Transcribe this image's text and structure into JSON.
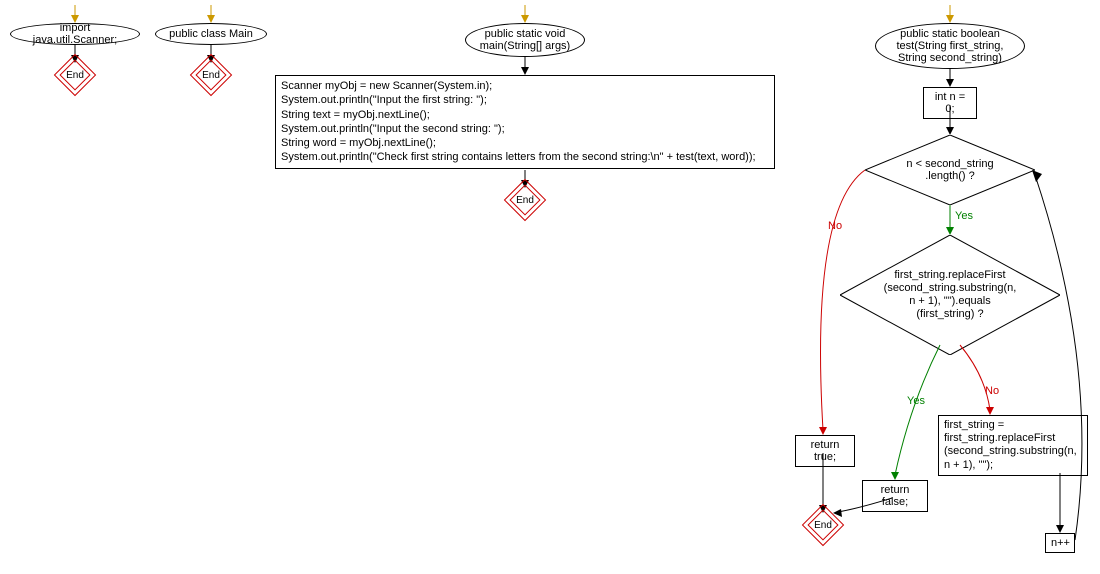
{
  "flowchart": {
    "nodes": {
      "import_scanner": "import java.util.Scanner;",
      "public_class_main": "public class Main",
      "main_method": "public static void\nmain(String[] args)",
      "main_body": "Scanner myObj = new Scanner(System.in);\nSystem.out.println(\"Input the first string: \");\nString text = myObj.nextLine();\nSystem.out.println(\"Input the second string: \");\nString word = myObj.nextLine();\nSystem.out.println(\"Check first string contains letters from the second string:\\n\" + test(text, word));",
      "test_method": "public static boolean\ntest(String first_string,\nString second_string)",
      "int_n": "int n = 0;",
      "loop_cond": "n < second_string\n.length() ?",
      "if_cond": "first_string.replaceFirst\n(second_string.substring(n,\nn + 1), \"\").equals\n(first_string) ?",
      "return_true": "return true;",
      "return_false": "return false;",
      "replace_first": "first_string =\nfirst_string.replaceFirst\n(second_string.substring(n,\nn + 1), \"\");",
      "n_inc": "n++",
      "end": "End"
    },
    "labels": {
      "yes1": "Yes",
      "no1": "No",
      "yes2": "Yes",
      "no2": "No"
    }
  }
}
